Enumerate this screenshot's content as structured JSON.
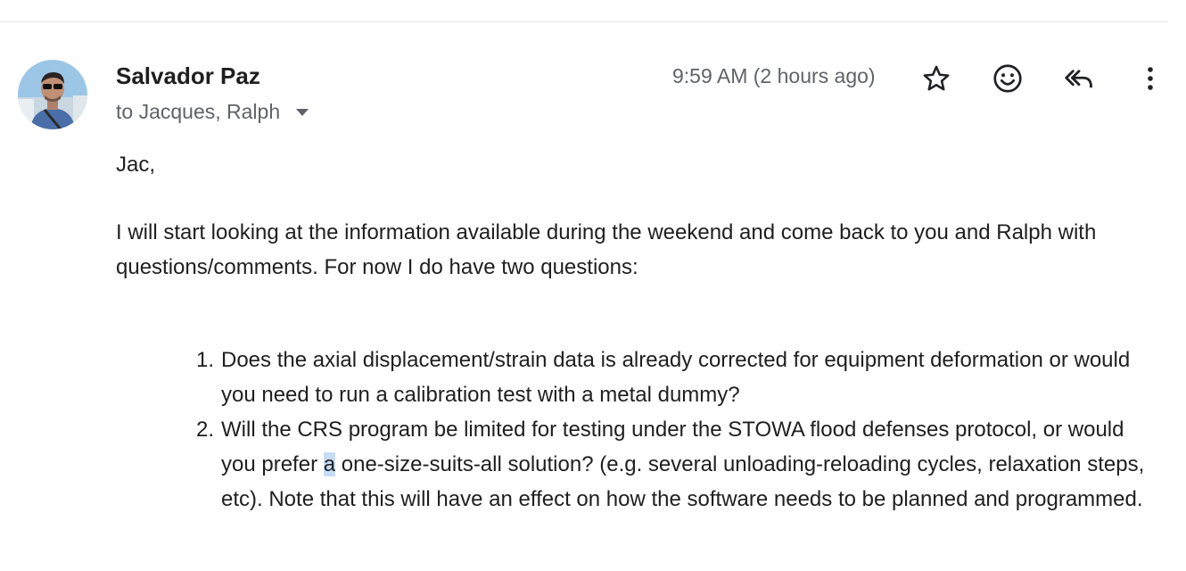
{
  "email": {
    "sender_name": "Salvador Paz",
    "recipients": "to Jacques, Ralph",
    "timestamp": "9:59 AM (2 hours ago)",
    "greeting": "Jac,",
    "paragraph": "I will start looking at the information available during the weekend and come back to you and Ralph with questions/comments. For now I do have two questions:",
    "questions": [
      {
        "number": "1.",
        "text": "Does the axial displacement/strain data is already corrected for equipment deformation or would you need to run a calibration test with a metal dummy?"
      },
      {
        "number": "2.",
        "text_before": "Will the CRS program be limited for testing under the STOWA flood defenses protocol, or would you prefer ",
        "text_highlight": "a",
        "text_after": " one-size-suits-all solution? (e.g. several unloading-reloading cycles, relaxation steps, etc). Note that this will have an effect on how the software needs to be planned and programmed."
      }
    ]
  },
  "icons": {
    "avatar": "avatar-photo",
    "recipients_caret": "caret-down-icon",
    "star": "star-icon",
    "emoji": "smiley-icon",
    "reply_all": "reply-all-icon",
    "more": "more-vert-icon"
  },
  "colors": {
    "secondary_text": "#5f6368",
    "selection_highlight": "#c6dcf7"
  }
}
